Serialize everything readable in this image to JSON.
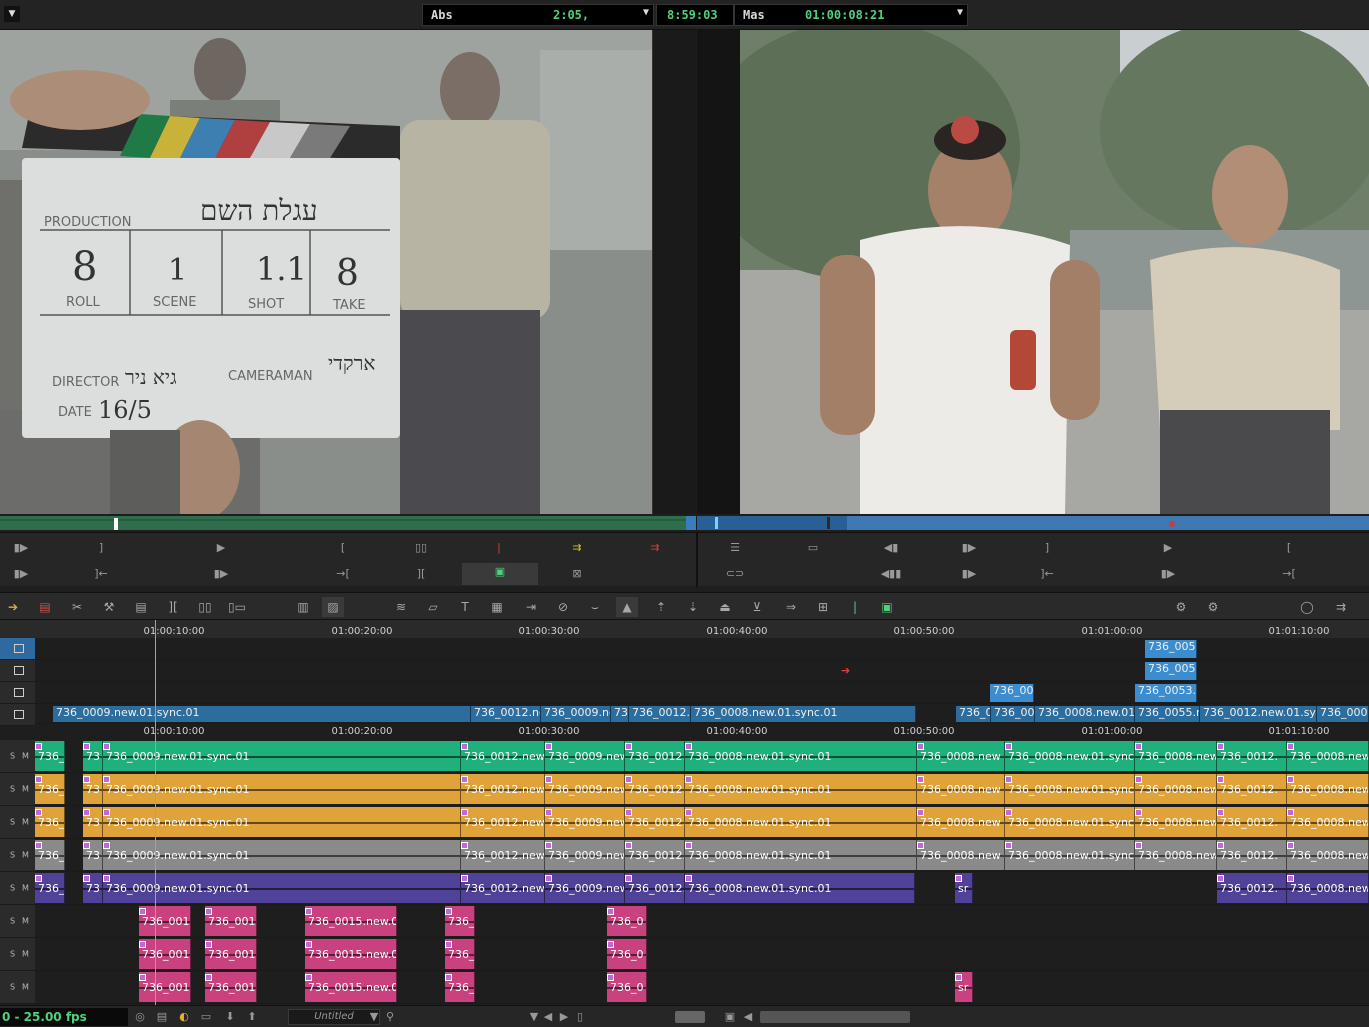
{
  "topbar": {
    "source_mode": "Abs",
    "source_timecode": "2:05,",
    "center_timecode": "8:59:03",
    "record_mode": "Mas",
    "record_timecode": "01:00:08:21"
  },
  "source_monitor": {
    "slate": {
      "production_label": "PRODUCTION",
      "production_value": "עגלת השם",
      "roll_label": "ROLL",
      "roll_value": "8",
      "scene_label": "SCENE",
      "scene_value": "1",
      "shot_label": "SHOT",
      "shot_value": "1.1",
      "take_label": "TAKE",
      "take_value": "8",
      "director_label": "DIRECTOR",
      "director_value": "גיא ניר",
      "cameraman_label": "CAMERAMAN",
      "cameraman_value": "ארקדי",
      "date_label": "DATE",
      "date_value": "16/5"
    }
  },
  "ruler": {
    "ticks": [
      "01:00:10:00",
      "01:00:20:00",
      "01:00:30:00",
      "01:00:40:00",
      "01:00:50:00",
      "01:01:00:00",
      "01:01:10:00"
    ]
  },
  "video_tracks": {
    "v1_clips": [
      "736_0009.new.01.sync.01",
      "736_0012.ne",
      "736_0009.ne",
      "73",
      "736_0012.n",
      "736_0008.new.01.sync.01",
      "736_0",
      "736_005",
      "736_0008.new.01.s",
      "736_0055.n",
      "736_0012.new.01.sync",
      "736_0008"
    ],
    "v2_clips": [
      "736_005"
    ],
    "v3_clips": [
      "736_0053.n"
    ],
    "v4_clips": [
      "736_0053."
    ],
    "v5_clips": [
      "736_0054"
    ]
  },
  "audio_tracks": {
    "track_label_s": "S",
    "track_label_m": "M",
    "sync_clips": [
      "736_0",
      "73",
      "736_0009.new.01.sync.01",
      "736_0012.new.",
      "736_0009.new",
      "736_0012.n",
      "736_0008.new.01.sync.01",
      "736_0008.new",
      "736_0008.new.01.sync.0",
      "736_0008.new.",
      "736_0012.",
      "736_0008.new."
    ],
    "purple_clips": [
      "736_0",
      "73",
      "736_0009.new.01.sync.01",
      "736_0012.new.",
      "736_0009.new",
      "736_0012.n",
      "736_0008.new.01.sync.01",
      "sr",
      "736_0012.",
      "736_0008.new."
    ],
    "pink_clips": [
      "736_001",
      "736_001",
      "736_0015.new.0",
      "736_",
      "736_0"
    ],
    "pink_clips_2": [
      "736_001",
      "736_001",
      "736_0015.new.0",
      "736_",
      "736_0"
    ],
    "pink_clips_3": [
      "736_001",
      "736_001",
      "736_0015.new.0",
      "736_",
      "736_0",
      "sr"
    ]
  },
  "statusbar": {
    "fps": "0 - 25.00 fps",
    "sequence_name": "Untitled"
  },
  "colors": {
    "timecode_green": "#4fd07a",
    "video_clip": "#2d6d9e",
    "audio_green": "#20b07c",
    "audio_orange": "#e0a33a",
    "audio_purple": "#4f4298",
    "audio_pink": "#c9427f"
  }
}
